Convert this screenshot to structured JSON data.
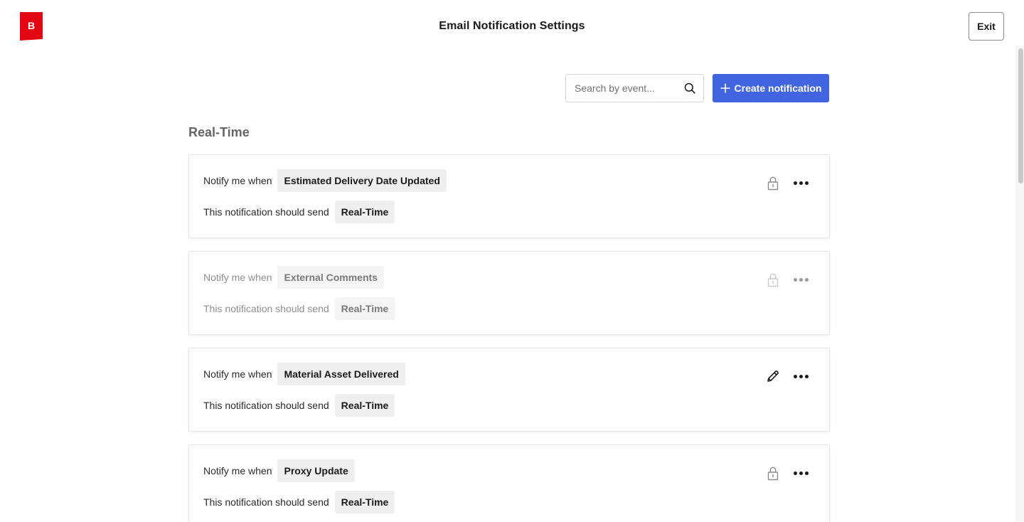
{
  "header": {
    "logo_letter": "B",
    "title": "Email Notification Settings",
    "exit_label": "Exit"
  },
  "toolbar": {
    "search_placeholder": "Search by event...",
    "create_label": "Create notification"
  },
  "section": {
    "heading": "Real-Time"
  },
  "cards": [
    {
      "label_when": "Notify me when",
      "event": "Estimated Delivery Date Updated",
      "label_send": "This notification should send",
      "frequency": "Real-Time",
      "status_icon": "lock-icon",
      "disabled": false
    },
    {
      "label_when": "Notify me when",
      "event": "External Comments",
      "label_send": "This notification should send",
      "frequency": "Real-Time",
      "status_icon": "lock-icon",
      "disabled": true
    },
    {
      "label_when": "Notify me when",
      "event": "Material Asset Delivered",
      "label_send": "This notification should send",
      "frequency": "Real-Time",
      "status_icon": "pencil-icon",
      "disabled": false
    },
    {
      "label_when": "Notify me when",
      "event": "Proxy Update",
      "label_send": "This notification should send",
      "frequency": "Real-Time",
      "status_icon": "lock-icon",
      "disabled": false
    }
  ],
  "colors": {
    "brand_red": "#e30613",
    "primary_blue": "#4165e0",
    "chip_bg": "#efefef"
  }
}
